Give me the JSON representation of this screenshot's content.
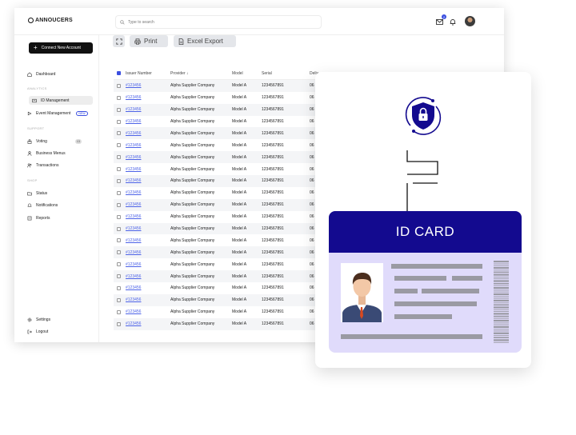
{
  "app": {
    "logo": "ANNOUCERS"
  },
  "search": {
    "placeholder": "Type to search"
  },
  "notifications": {
    "mail_count": "2"
  },
  "sidebar": {
    "connect_label": "Connect New Account",
    "dashboard": "Dashboard",
    "section_analytics": "ANALYTICS",
    "id_management": "ID Management",
    "event_management": "Event Management",
    "new_tag": "NEW",
    "section_support": "SUPPORT",
    "voting": "Voting",
    "voting_count": "13",
    "business_menus": "Business Menus",
    "transactions": "Transactions",
    "section_shop": "SHOP",
    "status": "Status",
    "notifications": "Notifications",
    "reports": "Reports",
    "settings": "Settings",
    "logout": "Logout"
  },
  "toolbar": {
    "print": "Print",
    "excel": "Excel Export"
  },
  "table": {
    "headers": [
      "Issuer Number",
      "Provider ↓",
      "Model",
      "Serial",
      "Deliv"
    ],
    "rows": [
      [
        "#123456",
        "Alpha Supplier Company",
        "Model A",
        "1234567891",
        "06"
      ],
      [
        "#123456",
        "Alpha Supplier Company",
        "Model A",
        "1234567891",
        "06"
      ],
      [
        "#123456",
        "Alpha Supplier Company",
        "Model A",
        "1234567891",
        "06"
      ],
      [
        "#123456",
        "Alpha Supplier Company",
        "Model A",
        "1234567891",
        "06"
      ],
      [
        "#123456",
        "Alpha Supplier Company",
        "Model A",
        "1234567891",
        "06"
      ],
      [
        "#123456",
        "Alpha Supplier Company",
        "Model A",
        "1234567891",
        "06"
      ],
      [
        "#123456",
        "Alpha Supplier Company",
        "Model A",
        "1234567891",
        "06"
      ],
      [
        "#123456",
        "Alpha Supplier Company",
        "Model A",
        "1234567891",
        "06"
      ],
      [
        "#123456",
        "Alpha Supplier Company",
        "Model A",
        "1234567891",
        "06"
      ],
      [
        "#123456",
        "Alpha Supplier Company",
        "Model A",
        "1234567891",
        "06"
      ],
      [
        "#123456",
        "Alpha Supplier Company",
        "Model A",
        "1234567891",
        "06"
      ],
      [
        "#123456",
        "Alpha Supplier Company",
        "Model A",
        "1234567891",
        "06"
      ],
      [
        "#123456",
        "Alpha Supplier Company",
        "Model A",
        "1234567891",
        "06"
      ],
      [
        "#123456",
        "Alpha Supplier Company",
        "Model A",
        "1234567891",
        "06"
      ],
      [
        "#123456",
        "Alpha Supplier Company",
        "Model A",
        "1234567891",
        "06"
      ],
      [
        "#123456",
        "Alpha Supplier Company",
        "Model A",
        "1234567891",
        "06"
      ],
      [
        "#123456",
        "Alpha Supplier Company",
        "Model A",
        "1234567891",
        "06"
      ],
      [
        "#123456",
        "Alpha Supplier Company",
        "Model A",
        "1234567891",
        "06"
      ],
      [
        "#123456",
        "Alpha Supplier Company",
        "Model A",
        "1234567891",
        "06"
      ],
      [
        "#123456",
        "Alpha Supplier Company",
        "Model A",
        "1234567891",
        "06"
      ],
      [
        "#123456",
        "Alpha Supplier Company",
        "Model A",
        "1234567891",
        "06"
      ]
    ]
  },
  "idcard": {
    "title": "ID CARD"
  },
  "colors": {
    "accent": "#3b4fe0",
    "card_header": "#130a8f",
    "card_body": "#e0dbfb"
  }
}
